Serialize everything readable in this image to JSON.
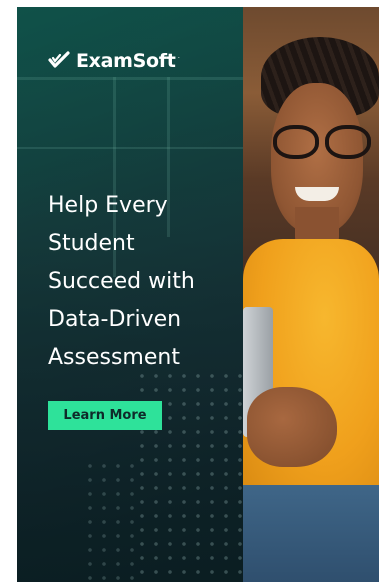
{
  "brand": {
    "name": "ExamSoft",
    "mark": "·",
    "logo_icon": "hand-check-icon",
    "accent_color": "#2ee29a",
    "panel_color": "#155f54"
  },
  "headline": {
    "lines": [
      "Help Every",
      "Student",
      "Succeed with",
      "Data-Driven",
      "Assessment"
    ]
  },
  "cta": {
    "label": "Learn More"
  }
}
